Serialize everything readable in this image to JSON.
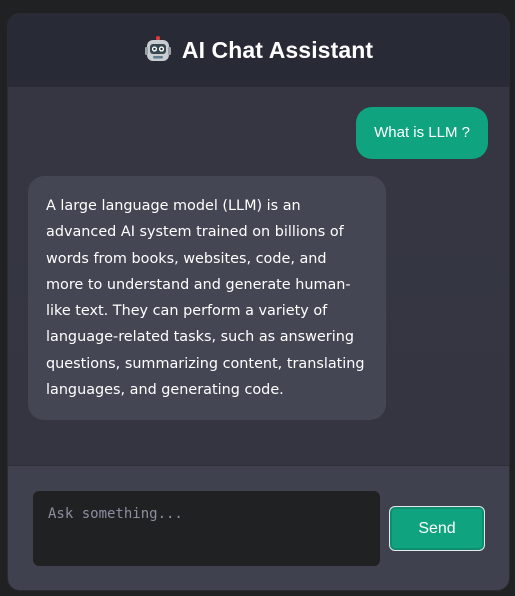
{
  "header": {
    "title": "AI Chat Assistant",
    "icon": "robot-icon"
  },
  "messages": [
    {
      "role": "user",
      "text": "What is LLM ?"
    },
    {
      "role": "assistant",
      "text": "A large language model (LLM) is an advanced AI system trained on billions of words from books, websites, code, and more to understand and generate human-like text. They can perform a variety of language-related tasks, such as answering questions, summarizing content, translating languages, and generating code."
    }
  ],
  "input": {
    "placeholder": "Ask something...",
    "value": ""
  },
  "send_button": {
    "label": "Send"
  },
  "colors": {
    "accent": "#10a37f",
    "background": "#343541",
    "header": "#282a36",
    "assistant_bubble": "#444654",
    "input_bar": "#40414f"
  }
}
